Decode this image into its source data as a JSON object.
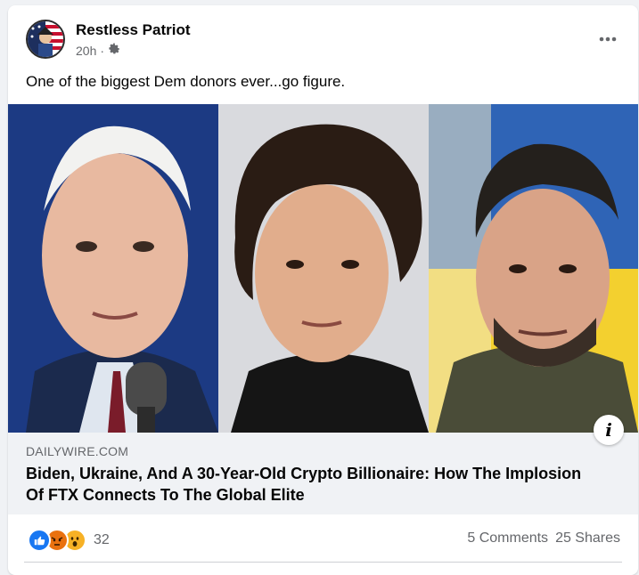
{
  "post": {
    "page_name": "Restless Patriot",
    "time": "20h",
    "separator": "·",
    "audience_icon": "gear-icon",
    "caption": "One of the biggest Dem donors ever...go figure."
  },
  "link": {
    "domain": "DAILYWIRE.COM",
    "headline": "Biden, Ukraine, And A 30-Year-Old Crypto Billionaire: How The Implosion Of FTX Connects To The Global Elite",
    "info_label": "i"
  },
  "footer": {
    "reaction_icons": [
      "like-icon",
      "angry-icon",
      "wow-icon"
    ],
    "reaction_count": "32",
    "comments": "5 Comments",
    "shares": "25 Shares"
  },
  "colors": {
    "like": "#1877f2",
    "angry": "#e9710f",
    "wow": "#f7b125",
    "muted_text": "#65676b"
  }
}
